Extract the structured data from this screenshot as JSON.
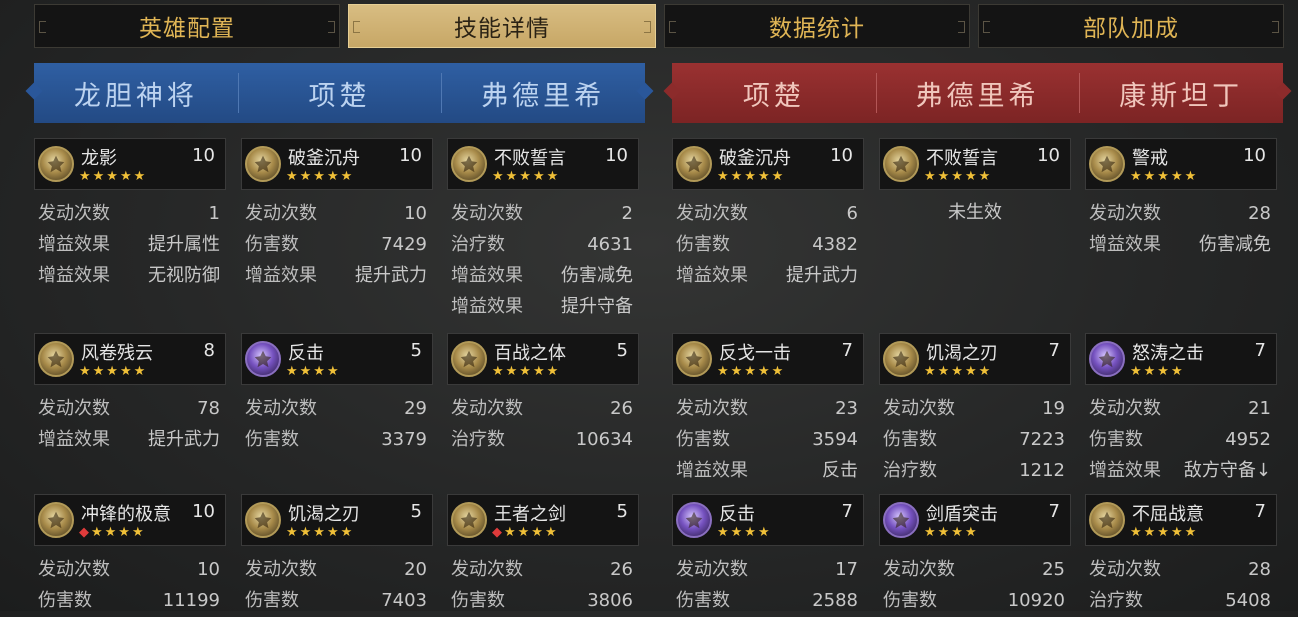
{
  "tabs": [
    {
      "label": "英雄配置",
      "active": false
    },
    {
      "label": "技能详情",
      "active": true
    },
    {
      "label": "数据统计",
      "active": false
    },
    {
      "label": "部队加成",
      "active": false
    }
  ],
  "left_team": {
    "color": "#2a579a",
    "heroes": [
      "龙胆神将",
      "项楚",
      "弗德里希"
    ]
  },
  "right_team": {
    "color": "#8c2b2b",
    "heroes": [
      "项楚",
      "弗德里希",
      "康斯坦丁"
    ]
  },
  "columns": [
    {
      "skills": [
        {
          "name": "龙影",
          "level": "10",
          "icon": "dragon-warrior-icon",
          "icon_style": "gold",
          "stars": "★★★★★",
          "red_star": false,
          "stats": [
            {
              "k": "发动次数",
              "v": "1"
            },
            {
              "k": "增益效果",
              "v": "提升属性"
            },
            {
              "k": "增益效果",
              "v": "无视防御"
            }
          ]
        },
        {
          "name": "风卷残云",
          "level": "8",
          "icon": "wind-warrior-icon",
          "icon_style": "gold",
          "stars": "★★★★★",
          "red_star": false,
          "stats": [
            {
              "k": "发动次数",
              "v": "78"
            },
            {
              "k": "增益效果",
              "v": "提升武力"
            }
          ]
        },
        {
          "name": "冲锋的极意",
          "level": "10",
          "icon": "charge-icon",
          "icon_style": "gold",
          "stars": "★★★★",
          "red_star": true,
          "stats": [
            {
              "k": "发动次数",
              "v": "10"
            },
            {
              "k": "伤害数",
              "v": "11199"
            }
          ]
        }
      ]
    },
    {
      "skills": [
        {
          "name": "破釜沉舟",
          "level": "10",
          "icon": "broken-cauldron-icon",
          "icon_style": "gold",
          "stars": "★★★★★",
          "red_star": false,
          "stats": [
            {
              "k": "发动次数",
              "v": "10"
            },
            {
              "k": "伤害数",
              "v": "7429"
            },
            {
              "k": "增益效果",
              "v": "提升武力"
            }
          ]
        },
        {
          "name": "反击",
          "level": "5",
          "icon": "counterattack-icon",
          "icon_style": "purple",
          "stars": "★★★★",
          "red_star": false,
          "stats": [
            {
              "k": "发动次数",
              "v": "29"
            },
            {
              "k": "伤害数",
              "v": "3379"
            }
          ]
        },
        {
          "name": "饥渴之刃",
          "level": "5",
          "icon": "thirsty-blade-icon",
          "icon_style": "gold",
          "stars": "★★★★★",
          "red_star": false,
          "stats": [
            {
              "k": "发动次数",
              "v": "20"
            },
            {
              "k": "伤害数",
              "v": "7403"
            }
          ]
        }
      ]
    },
    {
      "skills": [
        {
          "name": "不败誓言",
          "level": "10",
          "icon": "undefeated-oath-icon",
          "icon_style": "gold",
          "stars": "★★★★★",
          "red_star": false,
          "stats": [
            {
              "k": "发动次数",
              "v": "2"
            },
            {
              "k": "治疗数",
              "v": "4631"
            },
            {
              "k": "增益效果",
              "v": "伤害减免"
            },
            {
              "k": "增益效果",
              "v": "提升守备"
            }
          ]
        },
        {
          "name": "百战之体",
          "level": "5",
          "icon": "veteran-body-icon",
          "icon_style": "gold",
          "stars": "★★★★★",
          "red_star": false,
          "stats": [
            {
              "k": "发动次数",
              "v": "26"
            },
            {
              "k": "治疗数",
              "v": "10634"
            }
          ]
        },
        {
          "name": "王者之剑",
          "level": "5",
          "icon": "kings-sword-icon",
          "icon_style": "gold",
          "stars": "★★★★",
          "red_star": true,
          "stats": [
            {
              "k": "发动次数",
              "v": "26"
            },
            {
              "k": "伤害数",
              "v": "3806"
            }
          ]
        }
      ]
    },
    {
      "skills": [
        {
          "name": "破釜沉舟",
          "level": "10",
          "icon": "broken-cauldron-icon",
          "icon_style": "gold",
          "stars": "★★★★★",
          "red_star": false,
          "stats": [
            {
              "k": "发动次数",
              "v": "6"
            },
            {
              "k": "伤害数",
              "v": "4382"
            },
            {
              "k": "增益效果",
              "v": "提升武力"
            }
          ]
        },
        {
          "name": "反戈一击",
          "level": "7",
          "icon": "backstrike-icon",
          "icon_style": "gold",
          "stars": "★★★★★",
          "red_star": false,
          "stats": [
            {
              "k": "发动次数",
              "v": "23"
            },
            {
              "k": "伤害数",
              "v": "3594"
            },
            {
              "k": "增益效果",
              "v": "反击"
            }
          ]
        },
        {
          "name": "反击",
          "level": "7",
          "icon": "counterattack-icon",
          "icon_style": "purple",
          "stars": "★★★★",
          "red_star": false,
          "stats": [
            {
              "k": "发动次数",
              "v": "17"
            },
            {
              "k": "伤害数",
              "v": "2588"
            }
          ]
        }
      ]
    },
    {
      "skills": [
        {
          "name": "不败誓言",
          "level": "10",
          "icon": "undefeated-oath-icon",
          "icon_style": "gold",
          "stars": "★★★★★",
          "red_star": false,
          "not_effective": "未生效",
          "stats": []
        },
        {
          "name": "饥渴之刃",
          "level": "7",
          "icon": "thirsty-blade-icon",
          "icon_style": "gold",
          "stars": "★★★★★",
          "red_star": false,
          "stats": [
            {
              "k": "发动次数",
              "v": "19"
            },
            {
              "k": "伤害数",
              "v": "7223"
            },
            {
              "k": "治疗数",
              "v": "1212"
            }
          ]
        },
        {
          "name": "剑盾突击",
          "level": "7",
          "icon": "sword-shield-icon",
          "icon_style": "purple",
          "stars": "★★★★",
          "red_star": false,
          "stats": [
            {
              "k": "发动次数",
              "v": "25"
            },
            {
              "k": "伤害数",
              "v": "10920"
            }
          ]
        }
      ]
    },
    {
      "skills": [
        {
          "name": "警戒",
          "level": "10",
          "icon": "vigilance-icon",
          "icon_style": "gold",
          "stars": "★★★★★",
          "red_star": false,
          "stats": [
            {
              "k": "发动次数",
              "v": "28"
            },
            {
              "k": "增益效果",
              "v": "伤害减免"
            }
          ]
        },
        {
          "name": "怒涛之击",
          "level": "7",
          "icon": "raging-wave-icon",
          "icon_style": "purple",
          "stars": "★★★★",
          "red_star": false,
          "stats": [
            {
              "k": "发动次数",
              "v": "21"
            },
            {
              "k": "伤害数",
              "v": "4952"
            },
            {
              "k": "增益效果",
              "v": "敌方守备↓"
            }
          ]
        },
        {
          "name": "不屈战意",
          "level": "7",
          "icon": "unyielding-will-icon",
          "icon_style": "gold",
          "stars": "★★★★★",
          "red_star": false,
          "stats": [
            {
              "k": "发动次数",
              "v": "28"
            },
            {
              "k": "治疗数",
              "v": "5408"
            }
          ]
        }
      ]
    }
  ]
}
